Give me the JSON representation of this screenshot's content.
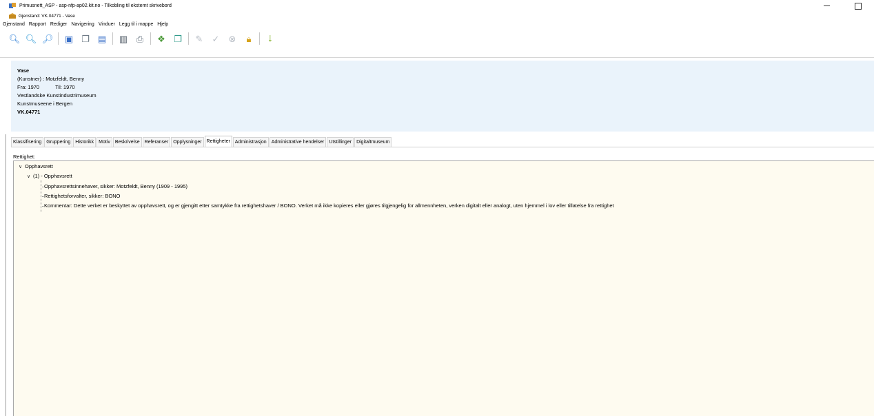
{
  "titlebar": {
    "title": "Primusnett_ASP - asp-nfp-ap02.kit.no - Tilkobling til eksternt skrivebord"
  },
  "document": {
    "title": "Gjenstand: VK.04771  - Vase"
  },
  "menu": {
    "items": [
      "Gjenstand",
      "Rapport",
      "Rediger",
      "Navigering",
      "Vinduer",
      "Legg til i mappe",
      "Hjelp"
    ]
  },
  "toolbar": {
    "icons": [
      "search-icon",
      "search-next-icon",
      "advanced-search-icon",
      "new-record-icon",
      "copy-record-icon",
      "report-icon",
      "barcode-icon",
      "print-icon",
      "link-icon",
      "multi-window-icon",
      "edit-icon",
      "approve-icon",
      "cancel-icon",
      "lock-icon",
      "download-arrow-icon"
    ]
  },
  "info": {
    "name": "Vase",
    "artist": "(Kunstner) :  Motzfeldt, Benny",
    "from": "Fra:  1970",
    "to": "Til:  1970",
    "museum": "Vestlandske Kunstindustrimuseum",
    "owner": "Kunstmuseene i Bergen",
    "id": "VK.04771"
  },
  "tabs": [
    {
      "label": "Klassifisering",
      "active": false
    },
    {
      "label": "Gruppering",
      "active": false
    },
    {
      "label": "Historikk",
      "active": false
    },
    {
      "label": "Motiv",
      "active": false
    },
    {
      "label": "Beskrivelse",
      "active": false
    },
    {
      "label": "Referanser",
      "active": false
    },
    {
      "label": "Opplysninger",
      "active": false
    },
    {
      "label": "Rettigheter",
      "active": true
    },
    {
      "label": "Administrasjon",
      "active": false
    },
    {
      "label": "Administrative hendelser",
      "active": false
    },
    {
      "label": "Utstillinger",
      "active": false
    },
    {
      "label": "Digitaltmuseum",
      "active": false
    }
  ],
  "rights": {
    "section_label": "Rettighet:",
    "root": "Opphavsrett",
    "child": "(1) - Opphavsrett",
    "leaves": [
      "Opphavsrettsinnehaver, sikker: Motzfeldt, Benny  (1909  -  1995)",
      "Rettighetsforvalter, sikker: BONO",
      "Kommentar: Dette verket er beskyttet av opphavsrett, og er gjengitt etter samtykke fra rettighetshaver / BONO. Verket må ikke kopieres eller gjøres tilgjengelig for allmennheten, verken digitalt eller analogt, uten hjemmel i lov eller tillatelse fra rettighet"
    ]
  }
}
